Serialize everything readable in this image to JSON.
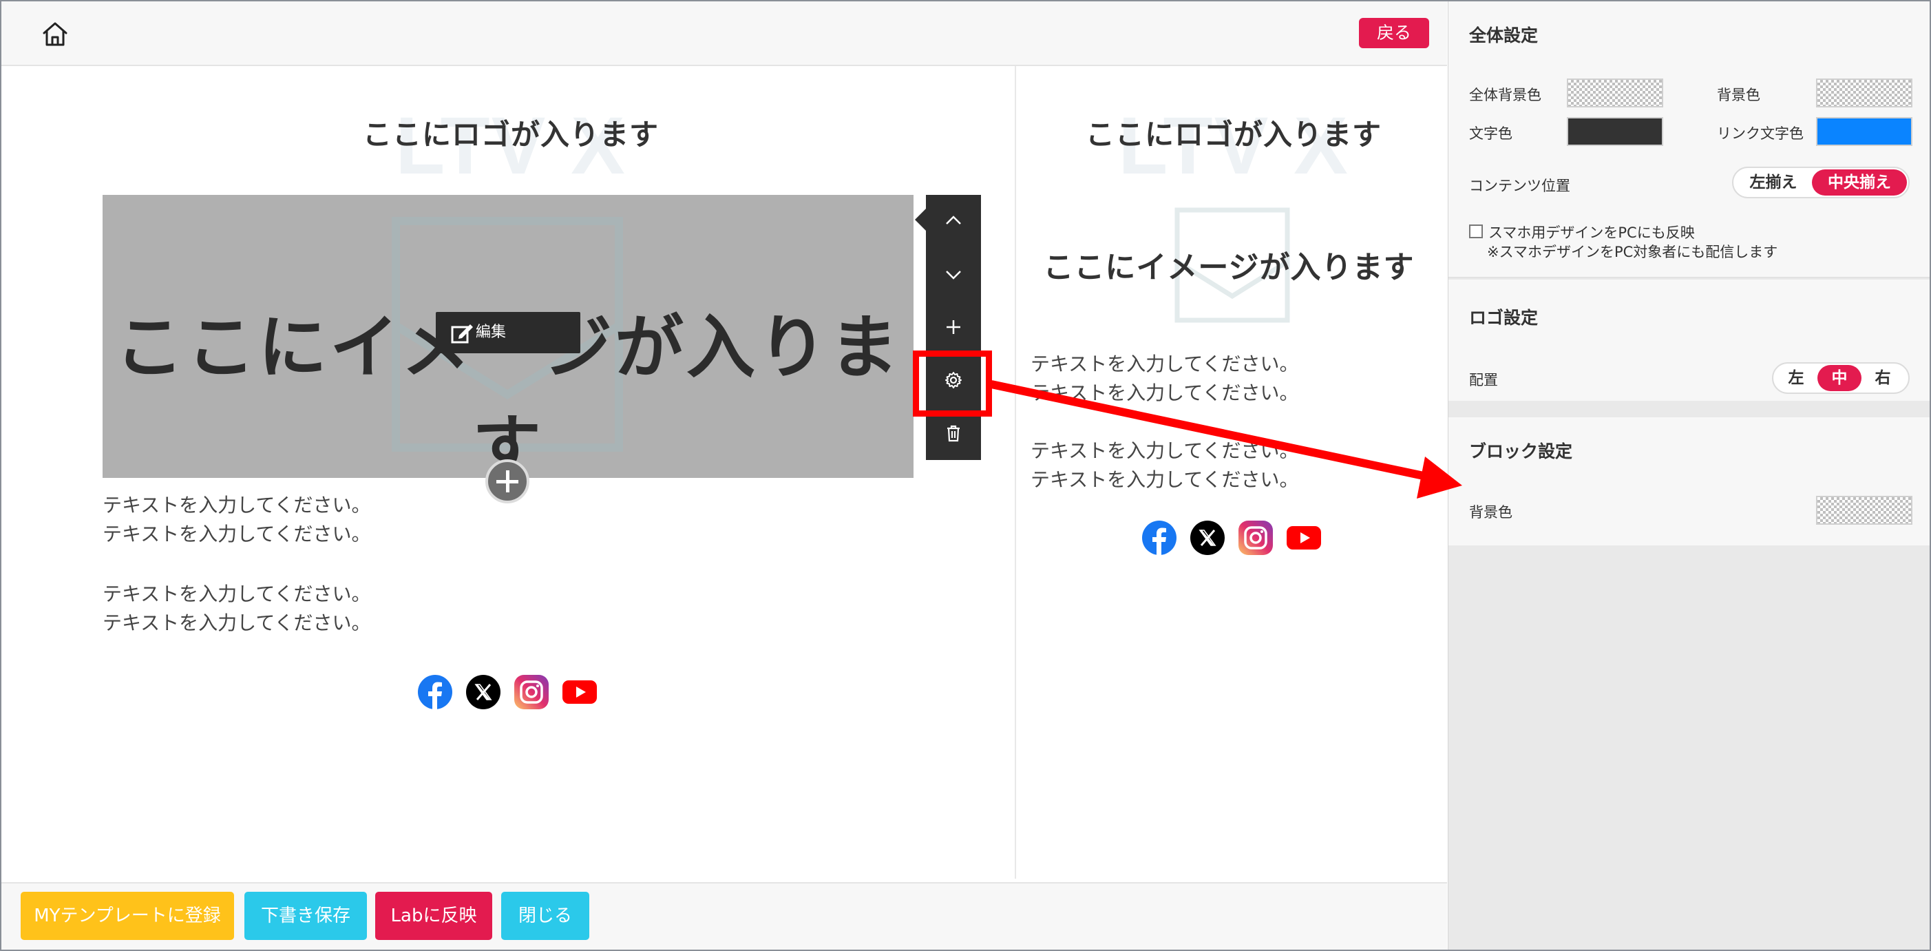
{
  "topbar": {
    "back_label": "戻る"
  },
  "pc_preview": {
    "logo_watermark": "LTV X",
    "logo_text": "ここにロゴが入ります",
    "image_caption": "ここにイメージが入ります",
    "edit_label": "編集",
    "text_para_1": "テキストを入力してください。\nテキストを入力してください。",
    "text_para_2": "テキストを入力してください。\nテキストを入力してください。"
  },
  "block_toolbar": {
    "items": [
      "chevron-up-icon",
      "chevron-down-icon",
      "plus-icon",
      "gear-icon",
      "trash-icon"
    ]
  },
  "sp_preview": {
    "logo_watermark": "LTV X",
    "logo_text": "ここにロゴが入ります",
    "image_caption": "ここにイメージが入ります",
    "text_para_1": "テキストを入力してください。\nテキストを入力してください。",
    "text_para_2": "テキストを入力してください。\nテキストを入力してください。"
  },
  "sns_icons": [
    "facebook-icon",
    "x-icon",
    "instagram-icon",
    "youtube-icon"
  ],
  "bottombar": {
    "my_template_label": "MYテンプレートに登録",
    "draft_label": "下書き保存",
    "lab_label": "Labに反映",
    "close_label": "閉じる"
  },
  "panel": {
    "global": {
      "title": "全体設定",
      "bg_all_label": "全体背景色",
      "bg_label": "背景色",
      "text_color_label": "文字色",
      "link_color_label": "リンク文字色",
      "text_color": "#333333",
      "link_color": "#0a84ff",
      "content_pos_label": "コンテンツ位置",
      "align_left": "左揃え",
      "align_center": "中央揃え",
      "sp_design_label": "スマホ用デザインをPCにも反映",
      "sp_design_note": "※スマホデザインをPC対象者にも配信します"
    },
    "logo": {
      "title": "ロゴ設定",
      "placement_label": "配置",
      "opt_left": "左",
      "opt_center": "中",
      "opt_right": "右"
    },
    "block": {
      "title": "ブロック設定",
      "bg_label": "背景色"
    }
  },
  "colors": {
    "accent": "#e31b4f",
    "cyan": "#2bc9ea",
    "yellow": "#ffc21a",
    "toolbar": "#2f2f2f",
    "annotation": "#ff0000"
  }
}
